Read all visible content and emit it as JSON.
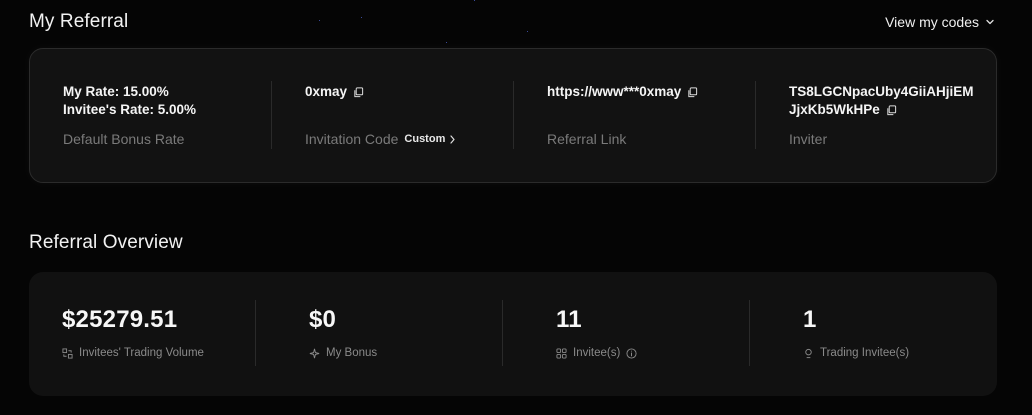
{
  "referral": {
    "title": "My Referral",
    "view_codes_label": "View my codes",
    "rate": {
      "my_rate": "My Rate: 15.00%",
      "invitee_rate": "Invitee's Rate: 5.00%",
      "label": "Default Bonus Rate"
    },
    "invitation_code": {
      "value": "0xmay",
      "label": "Invitation Code",
      "custom_label": "Custom"
    },
    "referral_link": {
      "value": "https://www***0xmay",
      "label": "Referral Link"
    },
    "inviter": {
      "line1": "TS8LGCNpacUby4GiiAHjiEM",
      "line2": "JjxKb5WkHPe",
      "label": "Inviter"
    }
  },
  "overview": {
    "title": "Referral Overview",
    "stats": [
      {
        "value": "$25279.51",
        "label": "Invitees' Trading Volume",
        "icon": "volume-icon"
      },
      {
        "value": "$0",
        "label": "My Bonus",
        "icon": "sparkle-icon"
      },
      {
        "value": "11",
        "label": "Invitee(s)",
        "icon": "grid-icon"
      },
      {
        "value": "1",
        "label": "Trading Invitee(s)",
        "icon": "user-icon"
      }
    ]
  },
  "colors": {
    "background": "#050505",
    "card": "#121212",
    "text_primary": "#f5f5f5",
    "text_muted": "#7a7a7a"
  }
}
